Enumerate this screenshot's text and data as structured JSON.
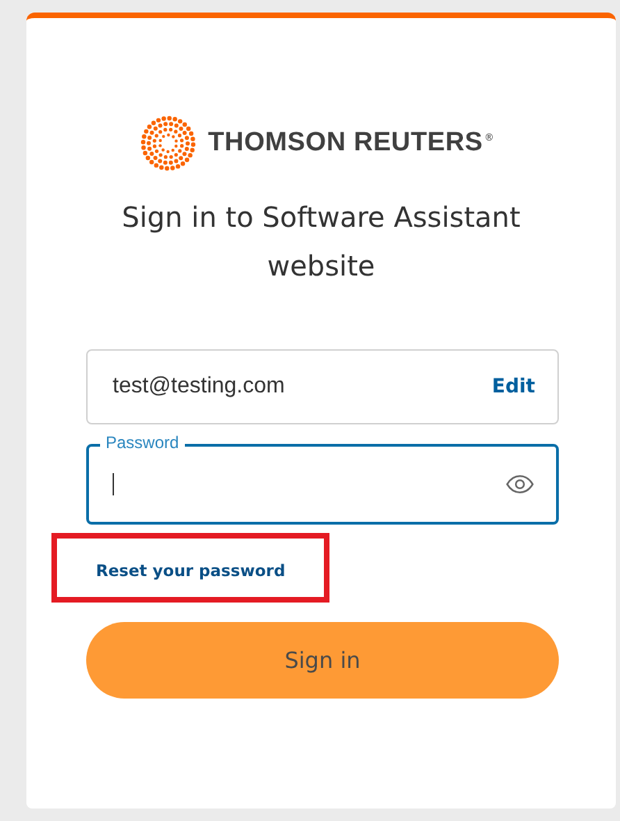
{
  "logo": {
    "text": "THOMSON REUTERS",
    "mark": "®"
  },
  "heading": "Sign in to Software Assistant website",
  "email_field": {
    "value": "test@testing.com",
    "action": "Edit"
  },
  "password_field": {
    "label": "Password",
    "focused": true
  },
  "reset_link": {
    "text": "Reset your password",
    "highlighted": true
  },
  "sign_in_button": {
    "label": "Sign in"
  }
}
